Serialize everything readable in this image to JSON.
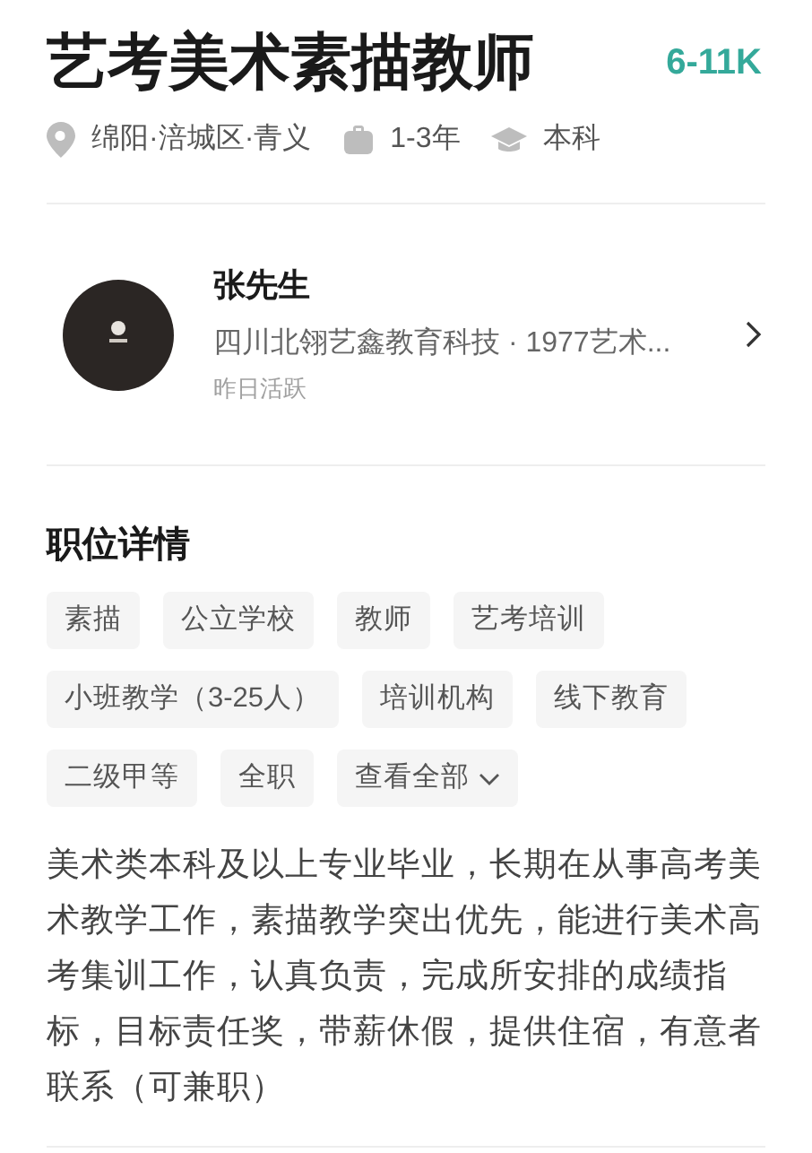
{
  "job": {
    "title": "艺考美术素描教师",
    "salary": "6-11K",
    "meta": [
      {
        "kind": "location",
        "text": "绵阳·涪城区·青义"
      },
      {
        "kind": "experience",
        "text": "1-3年"
      },
      {
        "kind": "education",
        "text": "本科"
      }
    ]
  },
  "recruiter": {
    "name": "张先生",
    "company": "四川北翎艺鑫教育科技 · 1977艺术...",
    "activity": "昨日活跃"
  },
  "details": {
    "heading": "职位详情",
    "tags": [
      {
        "kind": "tag",
        "text": "素描"
      },
      {
        "kind": "tag",
        "text": "公立学校"
      },
      {
        "kind": "tag",
        "text": "教师"
      },
      {
        "kind": "tag",
        "text": "艺考培训"
      },
      {
        "kind": "tag",
        "text": "小班教学（3-25人）"
      },
      {
        "kind": "tag",
        "text": "培训机构"
      },
      {
        "kind": "tag",
        "text": "线下教育"
      },
      {
        "kind": "tag",
        "text": "二级甲等"
      },
      {
        "kind": "tag",
        "text": "全职"
      },
      {
        "kind": "more",
        "text": "查看全部"
      }
    ],
    "description": "美术类本科及以上专业毕业，长期在从事高考美术教学工作，素描教学突出优先，能进行美术高考集训工作，认真负责，完成所安排的成绩指标，目标责任奖，带薪休假，提供住宿，有意者联系（可兼职）"
  }
}
